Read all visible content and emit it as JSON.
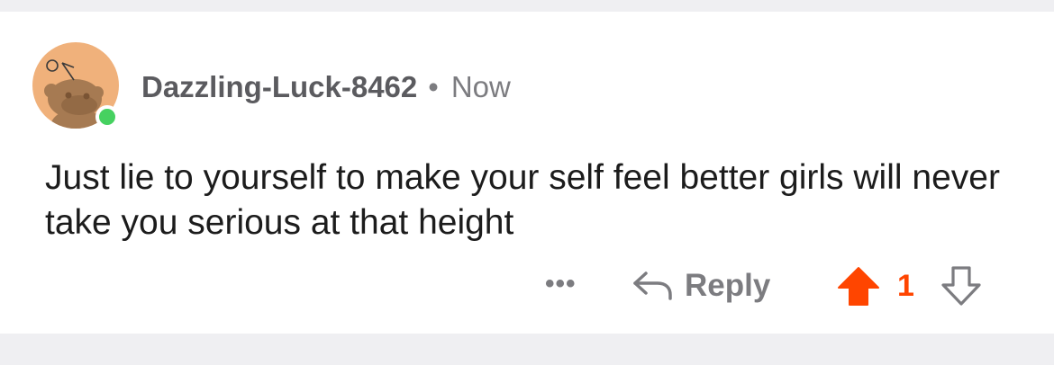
{
  "comment": {
    "author": "Dazzling-Luck-8462",
    "separator": "•",
    "timestamp": "Now",
    "body": "Just lie to yourself to make your self feel better girls will never take you serious at that height",
    "online": true
  },
  "actions": {
    "more_label": "•••",
    "reply_label": "Reply",
    "vote_count": "1",
    "upvoted": true
  },
  "icons": {
    "avatar": "snoo-avatar-icon",
    "more": "more-options-icon",
    "reply": "reply-arrow-icon",
    "upvote": "upvote-arrow-icon",
    "downvote": "downvote-arrow-icon"
  },
  "colors": {
    "upvote_active": "#ff4500",
    "online_status": "#46d160",
    "avatar_background": "#f0b17b",
    "muted_text": "#7c7c80"
  }
}
